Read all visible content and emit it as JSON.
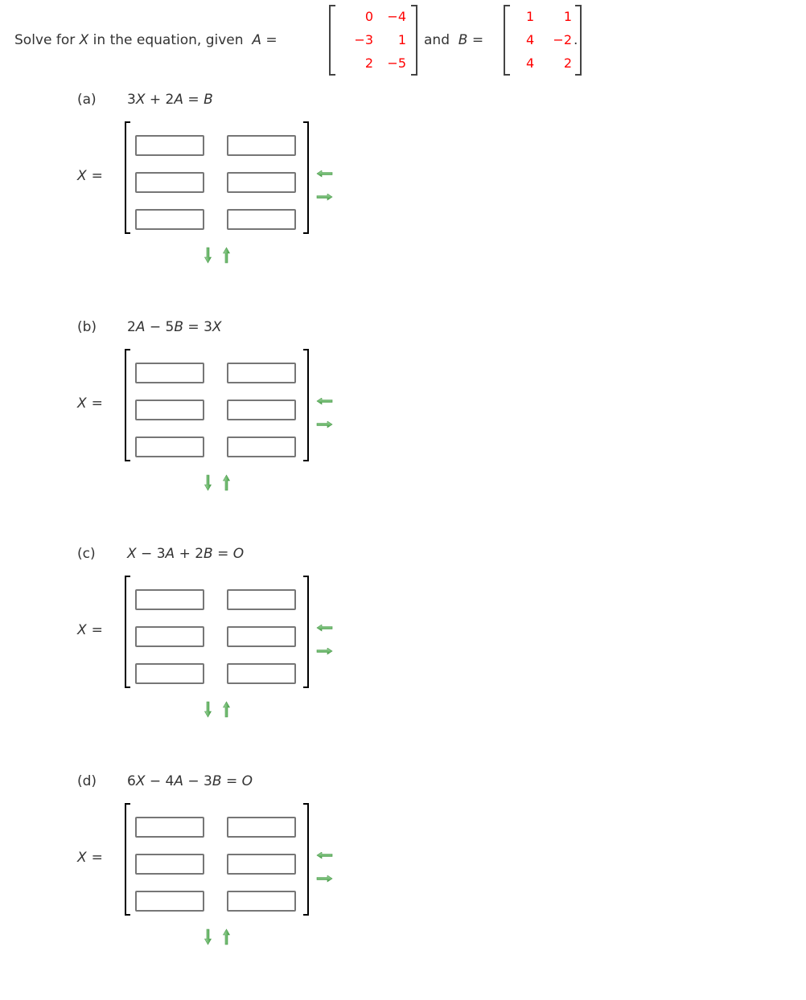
{
  "intro": {
    "prefix": "Solve for ",
    "var_x": "X",
    "middle": " in the equation, given ",
    "var_a": "A",
    "equals": " =",
    "and_text": "and",
    "var_b": "B",
    "equals_b": " =",
    "period": "."
  },
  "matrix_a": {
    "name": "A",
    "rows": [
      [
        "0",
        "−4"
      ],
      [
        "−3",
        "1"
      ],
      [
        "2",
        "−5"
      ]
    ],
    "color": "#ff0000"
  },
  "matrix_b": {
    "name": "B",
    "rows": [
      [
        "1",
        "1"
      ],
      [
        "4",
        "−2"
      ],
      [
        "4",
        "2"
      ]
    ],
    "color": "#ff0000"
  },
  "answer_prefix": {
    "var": "X",
    "equals": "="
  },
  "parts": [
    {
      "label": "(a)",
      "equation_parts": [
        [
          "3",
          ""
        ],
        [
          "X",
          "i"
        ],
        [
          " + 2",
          ""
        ],
        [
          "A",
          "i"
        ],
        [
          " = ",
          ""
        ],
        [
          "B",
          "i"
        ]
      ],
      "cells": [
        [
          "",
          ""
        ],
        [
          "",
          ""
        ],
        [
          "",
          ""
        ]
      ]
    },
    {
      "label": "(b)",
      "equation_parts": [
        [
          "2",
          ""
        ],
        [
          "A",
          "i"
        ],
        [
          " − 5",
          ""
        ],
        [
          "B",
          "i"
        ],
        [
          " = 3",
          ""
        ],
        [
          "X",
          "i"
        ]
      ],
      "cells": [
        [
          "",
          ""
        ],
        [
          "",
          ""
        ],
        [
          "",
          ""
        ]
      ]
    },
    {
      "label": "(c)",
      "equation_parts": [
        [
          "X",
          "i"
        ],
        [
          " − 3",
          ""
        ],
        [
          "A",
          "i"
        ],
        [
          " + 2",
          ""
        ],
        [
          "B",
          "i"
        ],
        [
          " = ",
          ""
        ],
        [
          "O",
          "i"
        ]
      ],
      "cells": [
        [
          "",
          ""
        ],
        [
          "",
          ""
        ],
        [
          "",
          ""
        ]
      ]
    },
    {
      "label": "(d)",
      "equation_parts": [
        [
          "6",
          ""
        ],
        [
          "X",
          "i"
        ],
        [
          " − 4",
          ""
        ],
        [
          "A",
          "i"
        ],
        [
          " − 3",
          ""
        ],
        [
          "B",
          "i"
        ],
        [
          " = ",
          ""
        ],
        [
          "O",
          "i"
        ]
      ],
      "cells": [
        [
          "",
          ""
        ],
        [
          "",
          ""
        ],
        [
          "",
          ""
        ]
      ]
    }
  ],
  "controls": {
    "remove_column_icon": "arrow-left-icon",
    "add_column_icon": "arrow-right-icon",
    "add_row_icon": "arrow-down-icon",
    "remove_row_icon": "arrow-up-icon",
    "arrow_color": "#5cb85c"
  }
}
